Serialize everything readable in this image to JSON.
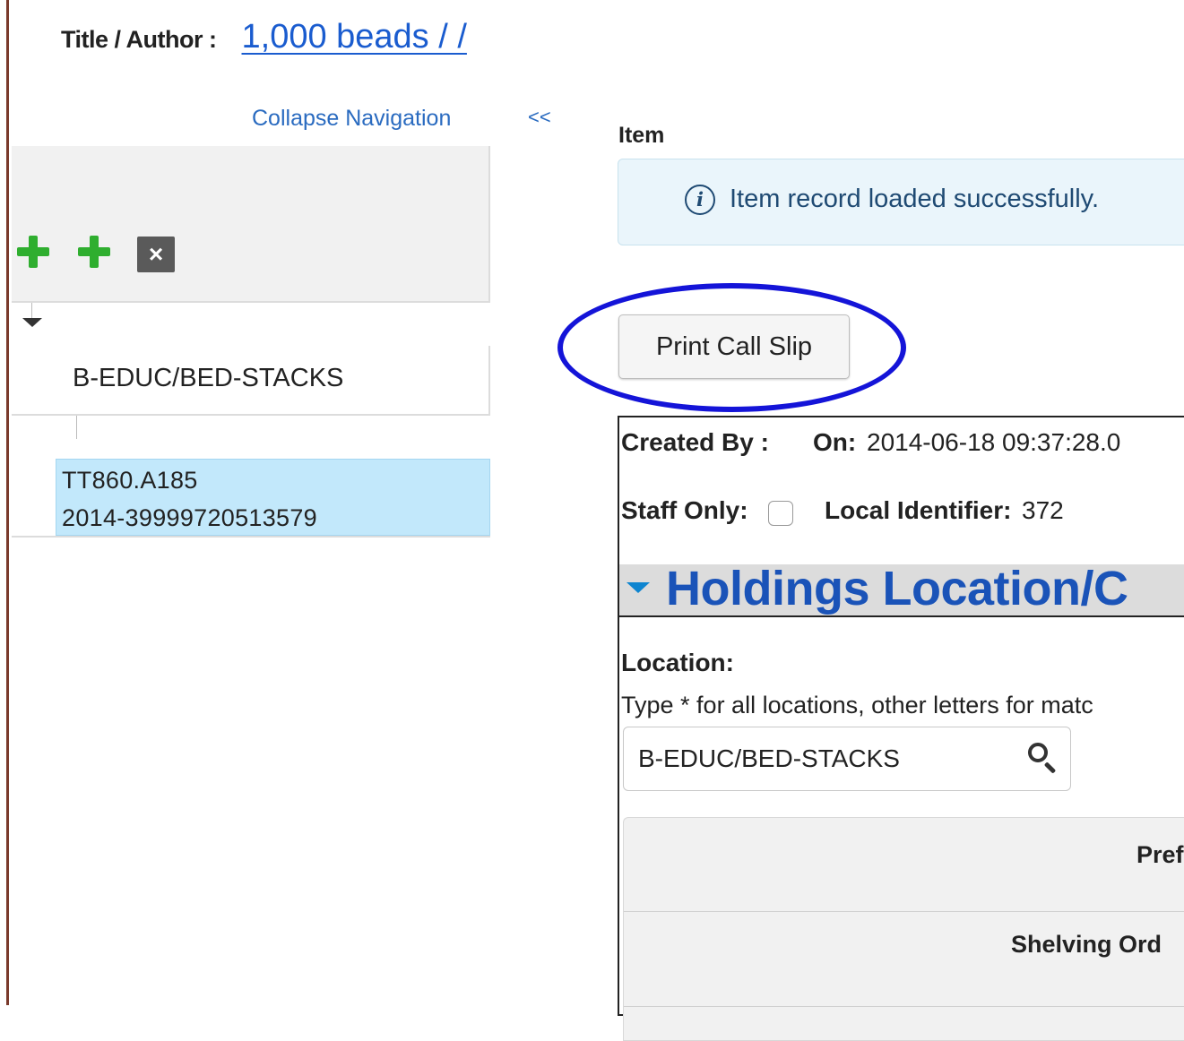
{
  "header": {
    "title_label": "Title / Author :",
    "title_value": "1,000 beads / /"
  },
  "navigation": {
    "collapse_label": "Collapse Navigation",
    "collapse_arrows": "<<"
  },
  "tree": {
    "delete_symbol": "×",
    "location_node": "B-EDUC/BED-STACKS",
    "item_node": {
      "call_number": "TT860.A185",
      "barcode": "2014-39999720513579"
    }
  },
  "item": {
    "heading": "Item",
    "alert_icon": "info-icon",
    "alert_text": "Item record loaded successfully.",
    "print_button_label": "Print Call Slip",
    "created_by_label": "Created By :",
    "on_label": "On:",
    "on_value": "2014-06-18 09:37:28.0",
    "staff_only_label": "Staff Only:",
    "staff_only_checked": false,
    "local_identifier_label": "Local Identifier:",
    "local_identifier_value": "372",
    "section_title": "Holdings Location/C",
    "location_label": "Location:",
    "location_hint": "Type * for all locations, other letters for matc",
    "location_value": "B-EDUC/BED-STACKS",
    "table_labels": [
      "Pref",
      "Shelving Ord"
    ]
  },
  "colors": {
    "link_blue": "#1a5ccf",
    "highlight_ring": "#1414d8",
    "selected_node": "#c2e8fb",
    "section_title": "#1a53b8",
    "plus_green": "#2fae2f"
  }
}
